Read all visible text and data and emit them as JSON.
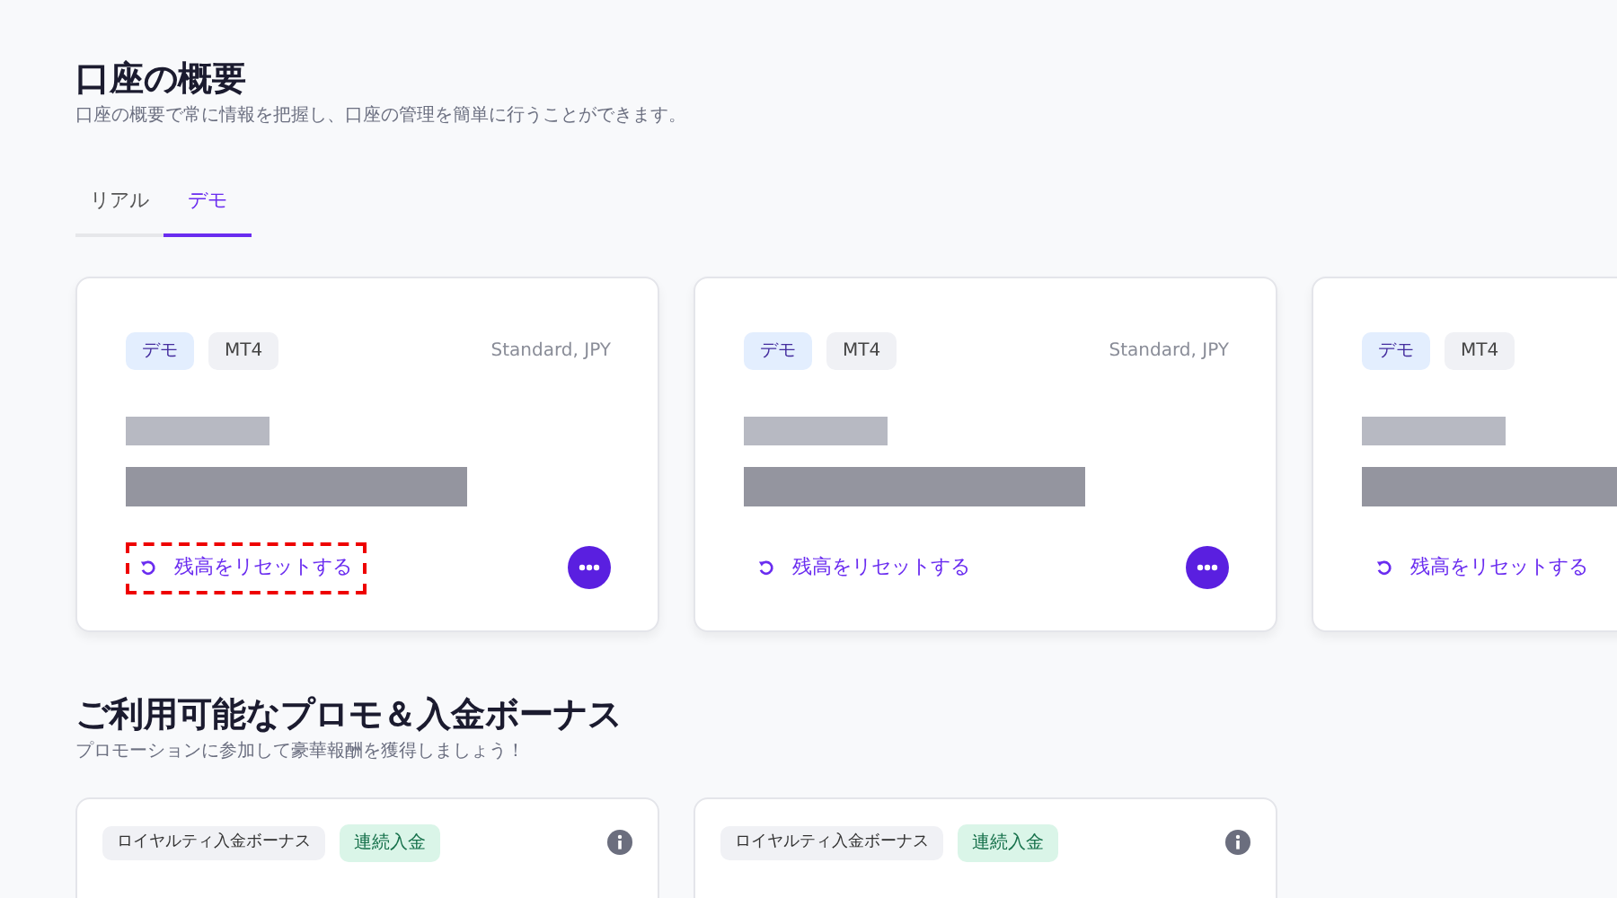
{
  "header": {
    "title": "口座の概要",
    "subtitle": "口座の概要で常に情報を把握し、口座の管理を簡単に行うことができます。"
  },
  "tabs": [
    {
      "label": "リアル",
      "selected": false
    },
    {
      "label": "デモ",
      "selected": true
    }
  ],
  "accounts": [
    {
      "badges": [
        {
          "label": "デモ",
          "kind": "type"
        },
        {
          "label": "MT4",
          "kind": "platform"
        }
      ],
      "account_type": "Standard, JPY",
      "reset_label": "残高をリセットする",
      "highlighted": true
    },
    {
      "badges": [
        {
          "label": "デモ",
          "kind": "type"
        },
        {
          "label": "MT4",
          "kind": "platform"
        }
      ],
      "account_type": "Standard, JPY",
      "reset_label": "残高をリセットする",
      "highlighted": false
    },
    {
      "badges": [
        {
          "label": "デモ",
          "kind": "type"
        },
        {
          "label": "MT4",
          "kind": "platform"
        }
      ],
      "reset_label": "残高をリセットする",
      "highlighted": false
    }
  ],
  "promos_section": {
    "title": "ご利用可能なプロモ＆入金ボーナス",
    "subtitle": "プロモーションに参加して豪華報酬を獲得しましょう！"
  },
  "promos": [
    {
      "tags": [
        {
          "label": "ロイヤルティ入金ボーナス",
          "kind": "category"
        },
        {
          "label": "連続入金",
          "kind": "status"
        }
      ]
    },
    {
      "tags": [
        {
          "label": "ロイヤルティ入金ボーナス",
          "kind": "category"
        },
        {
          "label": "連続入金",
          "kind": "status"
        }
      ]
    }
  ]
}
